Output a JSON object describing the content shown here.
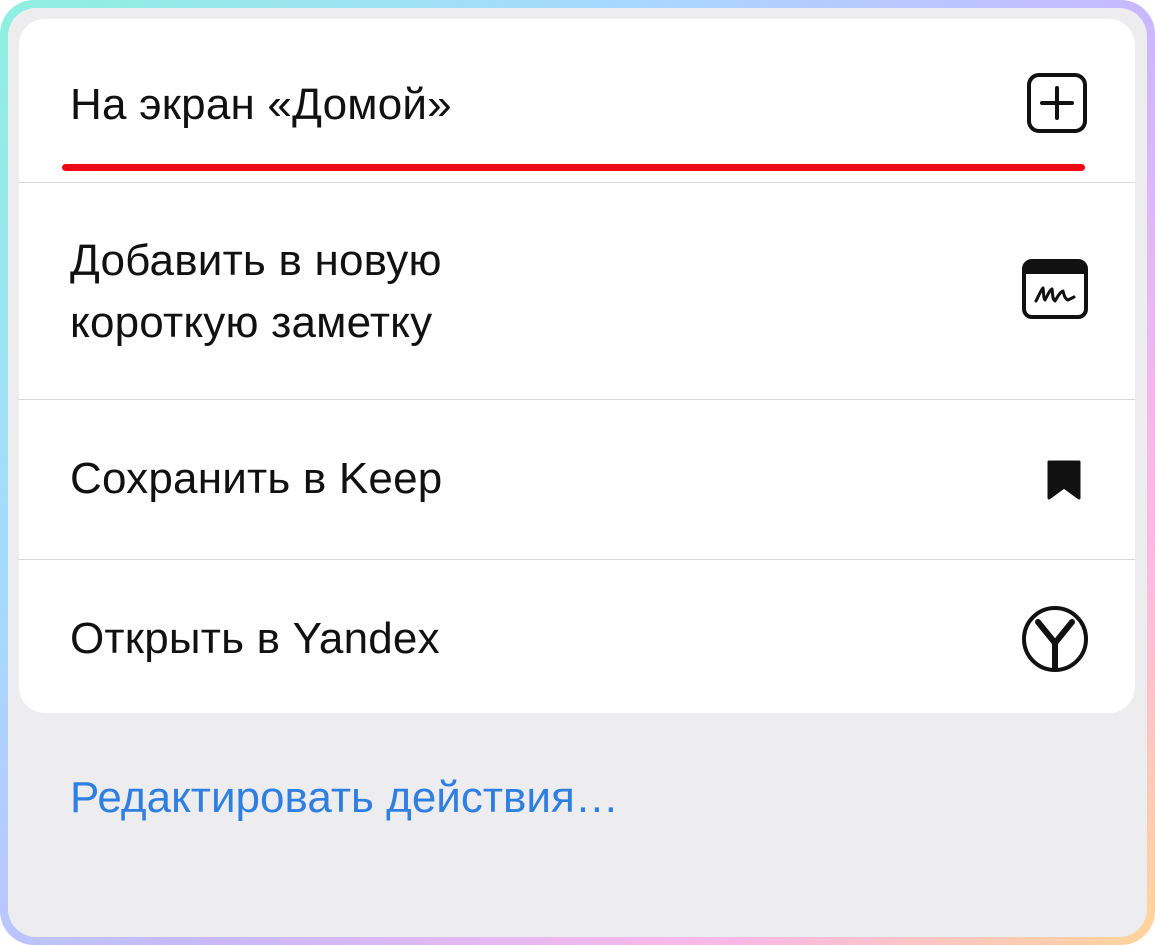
{
  "menu": {
    "items": [
      {
        "label": "На экран «Домой»",
        "icon": "add-to-home-icon"
      },
      {
        "label": "Добавить в новую\nкороткую заметку",
        "label_line1": "Добавить в новую",
        "label_line2": "короткую заметку",
        "icon": "quick-note-icon"
      },
      {
        "label": "Сохранить в Keep",
        "icon": "bookmark-icon"
      },
      {
        "label": "Открыть в Yandex",
        "icon": "yandex-icon"
      }
    ]
  },
  "footer": {
    "edit_actions_label": "Редактировать действия…"
  },
  "colors": {
    "highlight_underline": "#ee0a14",
    "link": "#2f7fe0",
    "text": "#111111",
    "sheet_background": "#ededf0"
  }
}
